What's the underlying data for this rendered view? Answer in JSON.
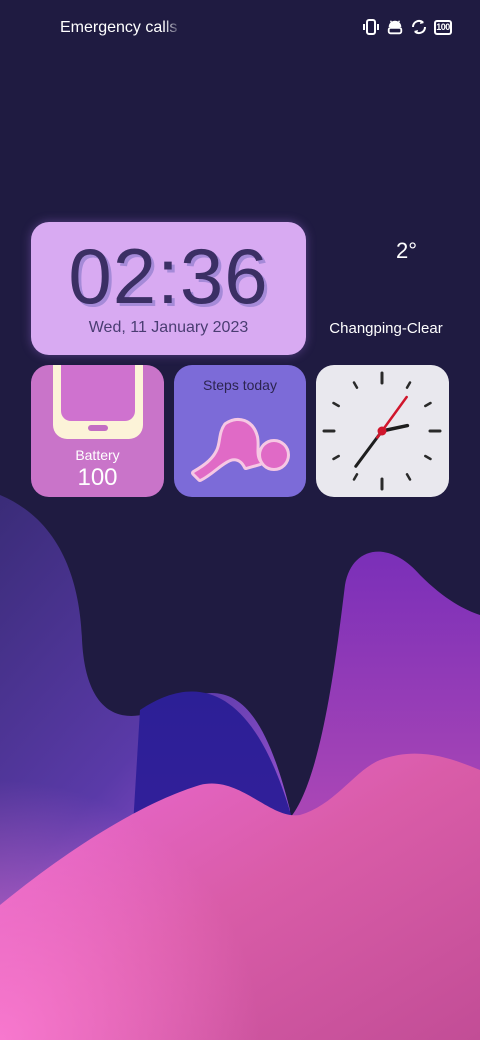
{
  "status_bar": {
    "text": "Emergency calls only",
    "icons": [
      "vibrate-icon",
      "android-icon",
      "sync-icon",
      "battery-icon"
    ],
    "battery_level": "100"
  },
  "clock_widget": {
    "time": "02:36",
    "date": "Wed, 11 January 2023"
  },
  "weather_widget": {
    "temperature": "2°",
    "location": "Changping-Clear"
  },
  "battery_widget": {
    "label": "Battery",
    "value": "100"
  },
  "steps_widget": {
    "label": "Steps today",
    "icon": "runner-icon"
  },
  "analog_clock": {
    "hour": 2,
    "minute": 36,
    "second": 6,
    "second_hand_color": "#d0162c"
  },
  "colors": {
    "background": "#1f1b41",
    "clock_widget_bg": "#d8aaf2",
    "battery_widget_bg": "#c974c9",
    "steps_widget_bg": "#7c6bd8",
    "analog_widget_bg": "#e9e8ee"
  }
}
